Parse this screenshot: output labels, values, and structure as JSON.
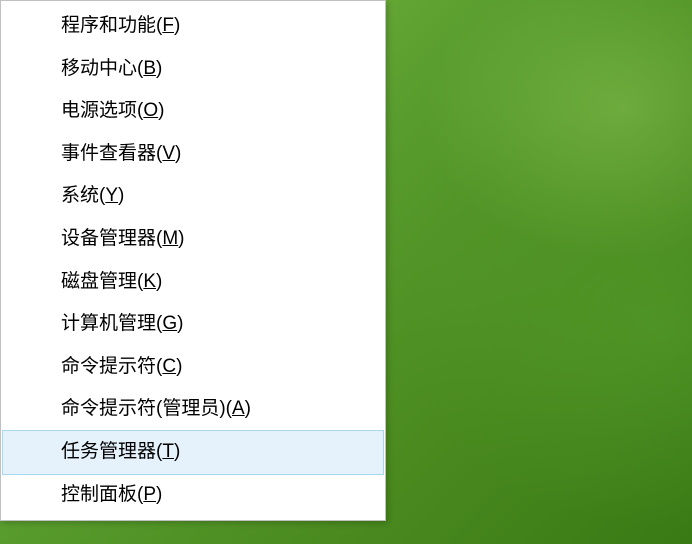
{
  "menu": {
    "items": [
      {
        "label": "程序和功能",
        "accelerator": "F",
        "highlighted": false
      },
      {
        "label": "移动中心",
        "accelerator": "B",
        "highlighted": false
      },
      {
        "label": "电源选项",
        "accelerator": "O",
        "highlighted": false
      },
      {
        "label": "事件查看器",
        "accelerator": "V",
        "highlighted": false
      },
      {
        "label": "系统",
        "accelerator": "Y",
        "highlighted": false
      },
      {
        "label": "设备管理器",
        "accelerator": "M",
        "highlighted": false
      },
      {
        "label": "磁盘管理",
        "accelerator": "K",
        "highlighted": false
      },
      {
        "label": "计算机管理",
        "accelerator": "G",
        "highlighted": false
      },
      {
        "label": "命令提示符",
        "accelerator": "C",
        "highlighted": false
      },
      {
        "label": "命令提示符(管理员)",
        "accelerator": "A",
        "highlighted": false
      },
      {
        "label": "任务管理器",
        "accelerator": "T",
        "highlighted": true
      },
      {
        "label": "控制面板",
        "accelerator": "P",
        "highlighted": false
      }
    ]
  }
}
